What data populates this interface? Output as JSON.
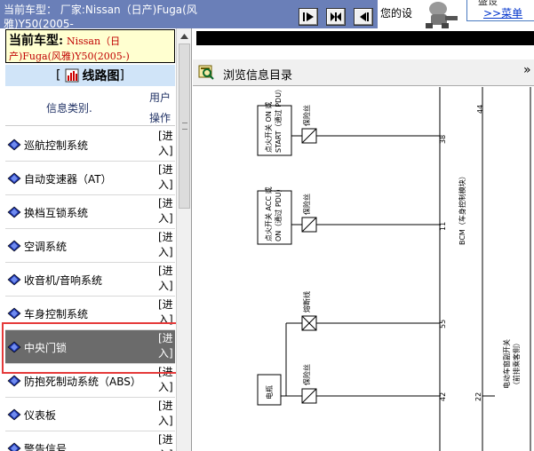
{
  "header": {
    "title_line1": "当前车型：",
    "title_maker": "厂家:Nissan（日产)Fuga(风",
    "title_line2": "雅)Y50(2005-",
    "welcome": "您的设",
    "promo_top": "盛设",
    "promo_link": ">>菜单"
  },
  "left": {
    "model_label": "当前车型:",
    "model_value_line1": "Nissan（日",
    "model_value_line2": "产)Fuga(风雅)Y50(2005-)",
    "diagram_title": "线路图",
    "bracket_open": "[",
    "bracket_close": "]",
    "col_category": "信息类别.",
    "col_user": "用户",
    "col_operation": "操作",
    "items": [
      {
        "label": "巡航控制系统",
        "action": "[进入]"
      },
      {
        "label": "自动变速器（AT）",
        "action": "[进入]"
      },
      {
        "label": "换档互锁系统",
        "action": "[进入]"
      },
      {
        "label": "空调系统",
        "action": "[进入]"
      },
      {
        "label": "收音机/音响系统",
        "action": "[进入]"
      },
      {
        "label": "车身控制系统",
        "action": "[进入]"
      },
      {
        "label": "中央门锁",
        "action": "[进入]"
      },
      {
        "label": "防抱死制动系统（ABS）",
        "action": "[进入]"
      },
      {
        "label": "仪表板",
        "action": "[进入]"
      },
      {
        "label": "警告信号",
        "action": "[进入]"
      }
    ]
  },
  "right": {
    "browse_label": "浏览信息目录",
    "chevron": "»"
  },
  "wiring": {
    "fuse_label": "保险丝",
    "fusible_link": "熔断线",
    "switch_start": "点火开关 ON 或",
    "switch_start_2": "START（通过 PDU）",
    "switch_acc": "点火开关 ACC 或",
    "switch_acc_2": "ON（通过 PDU）",
    "battery": "电瓶",
    "bcm": "BCM（车身控制模块）",
    "trunk_switch": "电动车窗副开关",
    "trunk_switch_2": "（前排乘客侧）",
    "pin_38": "38",
    "pin_11": "11",
    "pin_55": "55",
    "pin_42": "42",
    "pin_22": "22",
    "pin_44": "44"
  },
  "colors": {
    "topbar": "#6a7fb8",
    "highlight_border": "#e53a3a",
    "active_row": "#6b6b6b",
    "model_text": "#c00000",
    "title_bg": "#d0e4f8"
  }
}
